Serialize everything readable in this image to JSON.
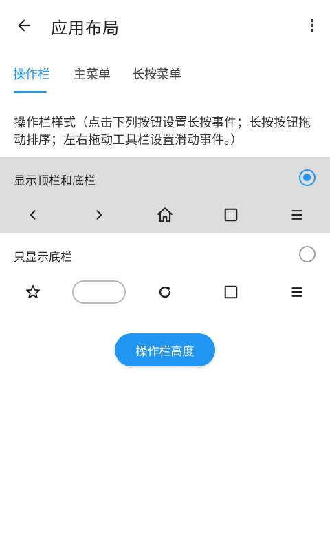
{
  "appbar": {
    "title": "应用布局",
    "back_icon": "arrow-left-icon",
    "more_icon": "more-vert-icon"
  },
  "tabs": [
    {
      "label": "操作栏",
      "active": true
    },
    {
      "label": "主菜单",
      "active": false
    },
    {
      "label": "长按菜单",
      "active": false
    }
  ],
  "description": "操作栏样式（点击下列按钮设置长按事件；长按按钮拖动排序；左右拖动工具栏设置滑动事件。）",
  "options": [
    {
      "label": "显示顶栏和底栏",
      "selected": true,
      "icons": [
        "chevron-left-icon",
        "chevron-right-icon",
        "home-icon",
        "square-icon",
        "menu-icon"
      ]
    },
    {
      "label": "只显示底栏",
      "selected": false,
      "icons": [
        "star-icon",
        "url-pill",
        "refresh-icon",
        "square-icon",
        "menu-icon"
      ]
    }
  ],
  "action_button": {
    "label": "操作栏高度"
  },
  "colors": {
    "accent": "#2196F3",
    "selected_bg": "#dcdcdc",
    "text": "#222222"
  }
}
